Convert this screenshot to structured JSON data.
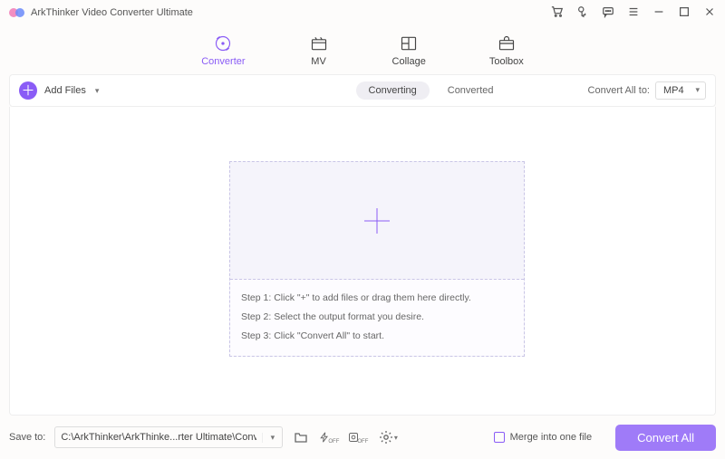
{
  "title": "ArkThinker Video Converter Ultimate",
  "nav": {
    "converter": "Converter",
    "mv": "MV",
    "collage": "Collage",
    "toolbox": "Toolbox"
  },
  "toolbar": {
    "add_files": "Add Files",
    "seg_converting": "Converting",
    "seg_converted": "Converted",
    "convert_all_to": "Convert All to:",
    "format_selected": "MP4"
  },
  "steps": {
    "s1": "Step 1: Click \"+\" to add files or drag them here directly.",
    "s2": "Step 2: Select the output format you desire.",
    "s3": "Step 3: Click \"Convert All\" to start."
  },
  "bottom": {
    "save_to": "Save to:",
    "path": "C:\\ArkThinker\\ArkThinke...rter Ultimate\\Converted",
    "merge": "Merge into one file",
    "convert_all": "Convert All",
    "off": "OFF"
  }
}
